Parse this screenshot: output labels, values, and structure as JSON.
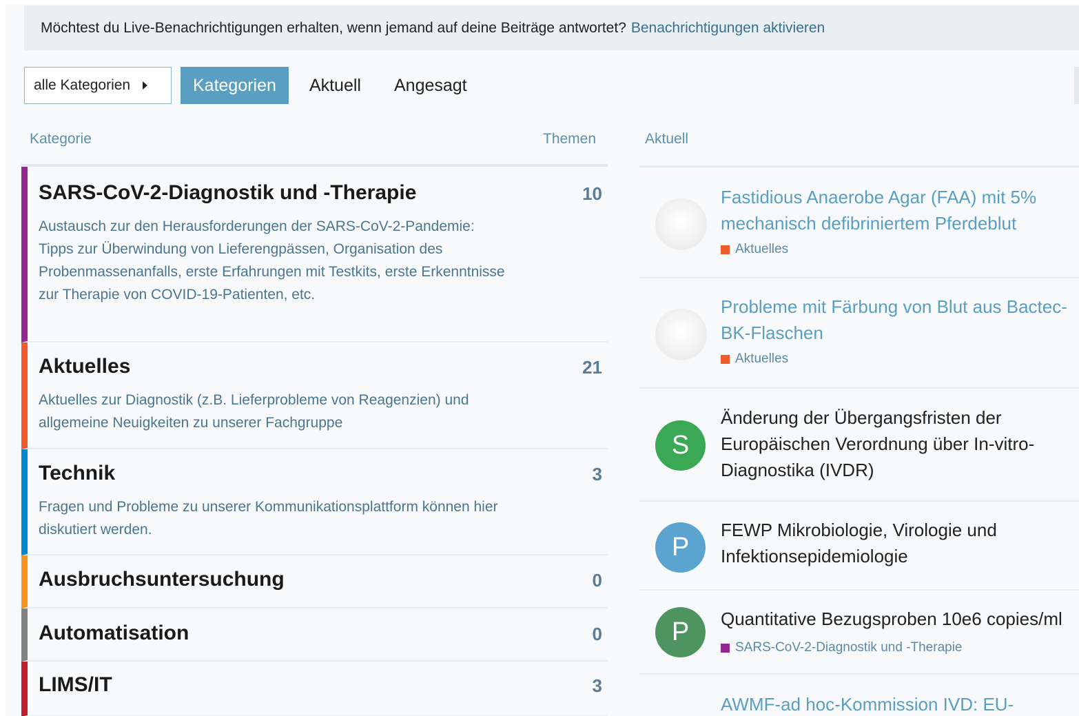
{
  "banner": {
    "text": "Möchtest du Live-Benachrichtigungen erhalten, wenn jemand auf deine Beiträge antwortet?",
    "link": "Benachrichtigungen aktivieren"
  },
  "nav": {
    "dropdown_label": "alle Kategorien",
    "tabs": [
      {
        "label": "Kategorien",
        "active": true
      },
      {
        "label": "Aktuell",
        "active": false
      },
      {
        "label": "Angesagt",
        "active": false
      }
    ]
  },
  "headers": {
    "category": "Kategorie",
    "topics": "Themen",
    "latest": "Aktuell"
  },
  "categories": [
    {
      "name": "SARS-CoV-2-Diagnostik und -Therapie",
      "description": "Austausch zur den Herausforderungen der SARS-CoV-2-Pandemie: Tipps zur Überwindung von Lieferengpässen, Organisation des Probenmassenanfalls, erste Erfahrungen mit Testkits, erste Erkenntnisse zur Therapie von COVID-19-Patienten, etc.",
      "count": "10",
      "color": "#92278f"
    },
    {
      "name": "Aktuelles",
      "description": "Aktuelles zur Diagnostik (z.B. Lieferprobleme von Reagenzien) und allgemeine Neuigkeiten zu unserer Fachgruppe",
      "count": "21",
      "color": "#f15a2a"
    },
    {
      "name": "Technik",
      "description": "Fragen und Probleme zu unserer Kommunikationsplattform können hier diskutiert werden.",
      "count": "3",
      "color": "#0088cc"
    },
    {
      "name": "Ausbruchsuntersuchung",
      "description": "",
      "count": "0",
      "color": "#f7941d"
    },
    {
      "name": "Automatisation",
      "description": "",
      "count": "0",
      "color": "#808281"
    },
    {
      "name": "LIMS/IT",
      "description": "",
      "count": "3",
      "color": "#bf1e2e"
    }
  ],
  "latest_topics": [
    {
      "title": "Fastidious Anaerobe Agar (FAA) mit 5% mechanisch defibriniertem Pferdeblut",
      "category": "Aktuelles",
      "category_color": "#f15a2a",
      "avatar_letter": "",
      "avatar_color": "",
      "state": "visited"
    },
    {
      "title": "Probleme mit Färbung von Blut aus Bactec-BK-Flaschen",
      "category": "Aktuelles",
      "category_color": "#f15a2a",
      "avatar_letter": "",
      "avatar_color": "",
      "state": "visited"
    },
    {
      "title": "Änderung der Übergangsfristen der Europäischen Verordnung über In-vitro-Diagnostika (IVDR)",
      "category": "",
      "category_color": "",
      "avatar_letter": "S",
      "avatar_color": "#3aa854",
      "state": "unread"
    },
    {
      "title": "FEWP Mikrobiologie, Virologie und Infektionsepidemiologie",
      "category": "",
      "category_color": "",
      "avatar_letter": "P",
      "avatar_color": "#5aa4cf",
      "state": "unread"
    },
    {
      "title": "Quantitative Bezugsproben 10e6 copies/ml",
      "category": "SARS-CoV-2-Diagnostik und -Therapie",
      "category_color": "#92278f",
      "avatar_letter": "P",
      "avatar_color": "#4d9460",
      "state": "unread"
    },
    {
      "title": "AWMF-ad hoc-Kommission IVD: EU-",
      "category": "",
      "category_color": "",
      "avatar_letter": "",
      "avatar_color": "",
      "state": "visited"
    }
  ]
}
